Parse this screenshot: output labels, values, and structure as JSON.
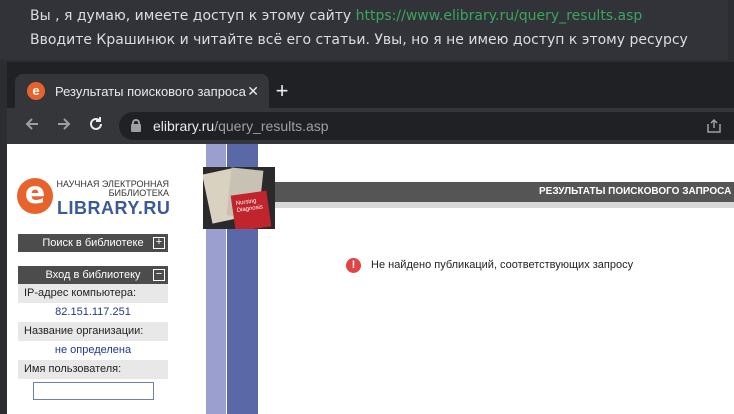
{
  "chat": {
    "line1_text": "Вы , я думаю, имеете доступ к этому сайту ",
    "line1_link": "https://www.elibrary.ru/query_results.asp",
    "line2_text": "Вводите Крашинюк и читайте всё его статьи. Увы, но я не имею доступ к этому ресурсу",
    "link_color": "#3ba55c"
  },
  "browser": {
    "tab_title": "Результаты поискового запроса",
    "tab_close": "✕",
    "new_tab": "+",
    "favicon_letter": "e",
    "url_host": "elibrary.ru",
    "url_path": "/query_results.asp",
    "icons": {
      "back": "arrow-left-icon",
      "forward": "arrow-right-icon",
      "reload": "reload-icon",
      "lock": "lock-icon",
      "share": "share-icon"
    }
  },
  "site": {
    "logo_letter": "e",
    "logo_small": "НАУЧНАЯ ЭЛЕКТРОННАЯ БИБЛИОТЕКА",
    "logo_big": "LIBRARY.RU",
    "brand_color": "#e8632b",
    "search_header": "Поиск в библиотеке",
    "search_toggle": "+",
    "login_header": "Вход в библиотеку",
    "login_toggle": "−",
    "ip_label": "IP-адрес компьютера:",
    "ip_value": "82.151.117.251",
    "org_label": "Название организации:",
    "org_value": "не определена",
    "user_label": "Имя пользователя:",
    "page_title": "РЕЗУЛЬТАТЫ ПОИСКОВОГО ЗАПРОСА",
    "notice_icon": "!",
    "notice_text": "Не найдено публикаций, соответствующих запросу",
    "mag_text": "Nursing Diagnosis"
  }
}
